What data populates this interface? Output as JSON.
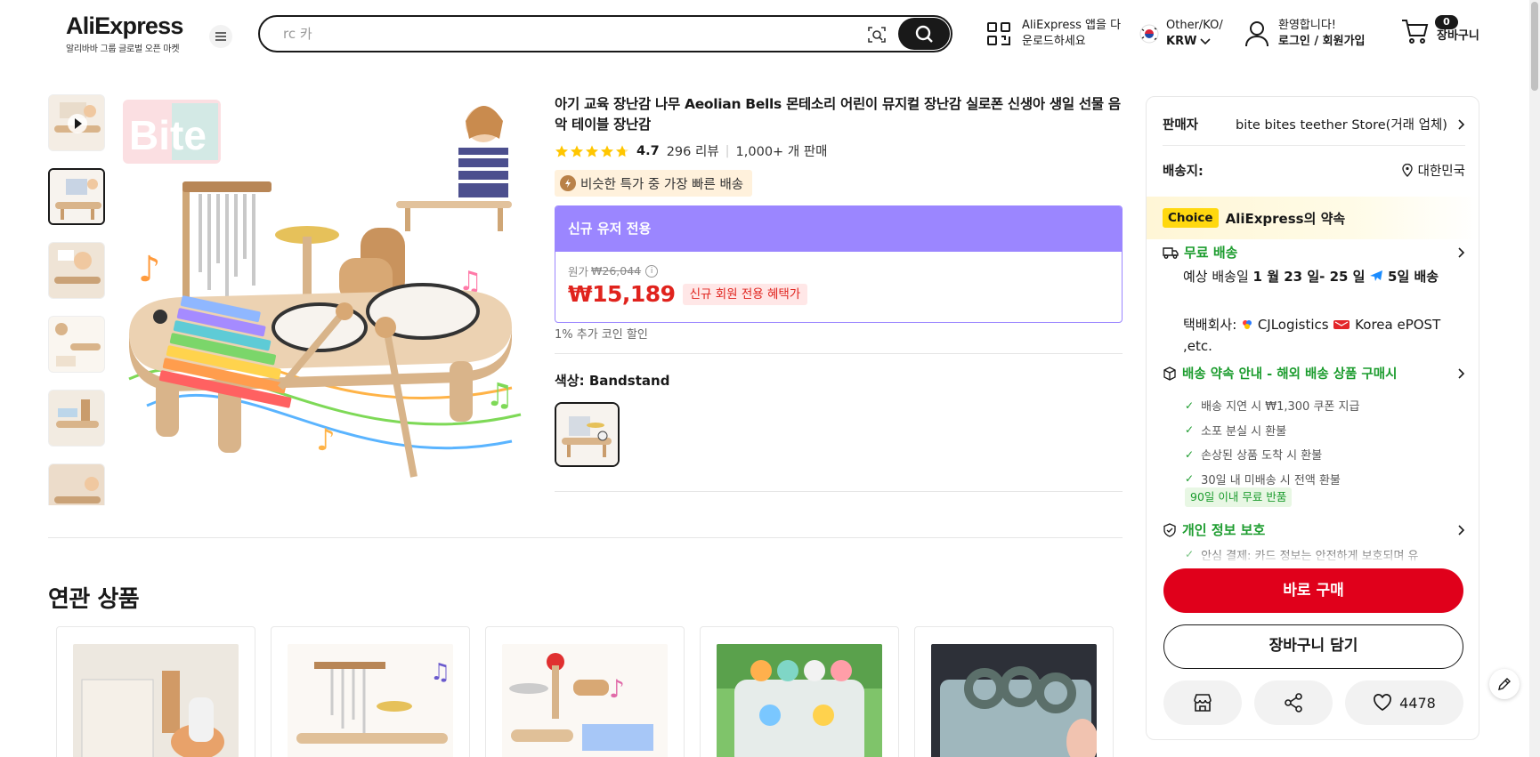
{
  "header": {
    "logo_main": "AliExpress",
    "logo_sub": "알리바바 그룹 글로벌 오픈 마켓",
    "search_placeholder": "rc 카",
    "app_line1": "AliExpress 앱을 다",
    "app_line2": "운로드하세요",
    "locale_line1": "Other/KO/",
    "locale_line2": "KRW",
    "welcome": "환영합니다!",
    "login": "로그인 / 회원가입",
    "cart_count": "0",
    "cart_label": "장바구니"
  },
  "product": {
    "title": "아기 교육 장난감 나무 Aeolian Bells 몬테소리 어린이 뮤지컬 장난감 실로폰 신생아 생일 선물 음악 테이블 장난감",
    "rating": "4.7",
    "reviews": "296 리뷰",
    "sold": "1,000+ 개 판매",
    "fast_badge": "비슷한 특가 중 가장 빠른 배송",
    "promo_header": "신규 유저 전용",
    "orig_label": "원가",
    "orig_price": "₩26,044",
    "price": "₩15,189",
    "price_tag": "신규 회원 전용 혜택가",
    "coin_note": "1% 추가 코인 할인",
    "color_label": "색상: ",
    "color_value": "Bandstand",
    "brand_mark": "Bite"
  },
  "related": {
    "title": "연관 상품"
  },
  "panel": {
    "seller_label": "판매자",
    "seller_name": "bite bites teether Store(거래 업체)",
    "ship_label": "배송지:",
    "ship_value": "대한민국",
    "choice_badge": "Choice",
    "choice_title": "AliExpress의 약속",
    "free_ship": "무료 배송",
    "delivery_pre": "예상 배송일 ",
    "delivery_date": "1 월 23 일- 25 일",
    "delivery_days": "5일 배송",
    "carrier_pre": "택배회사: ",
    "carrier_1": "CJLogistics",
    "carrier_2": "Korea ePOST ,etc.",
    "promise_title": "배송 약속 안내 - 해외 배송 상품 구매시",
    "checks": [
      "배송 지연 시 ₩1,300 쿠폰 지급",
      "소포 분실 시 환불",
      "손상된 상품 도착 시 환불",
      "30일 내 미배송 시 전액 환불"
    ],
    "return_badge": "90일 이내 무료 반품",
    "privacy_title": "개인 정보 보호",
    "secure_line": "안심 결제: 카드 정보는 안전하게 보호되며 유",
    "buy_now": "바로 구매",
    "add_cart": "장바구니 담기",
    "wish_count": "4478"
  },
  "colors": {
    "accent_red": "#e0001b",
    "price_red": "#e0231d",
    "promo_purple": "#9b86ff",
    "choice_yellow": "#ffd80f",
    "green": "#1c9c2e"
  },
  "icons": [
    "menu-icon",
    "camera-search-icon",
    "search-icon",
    "qr-code-icon",
    "korea-flag-icon",
    "user-icon",
    "cart-icon",
    "play-icon",
    "star-icon",
    "info-icon",
    "location-icon",
    "truck-icon",
    "shield-box-icon",
    "shield-check-icon",
    "store-icon",
    "share-icon",
    "heart-icon",
    "edit-icon"
  ]
}
